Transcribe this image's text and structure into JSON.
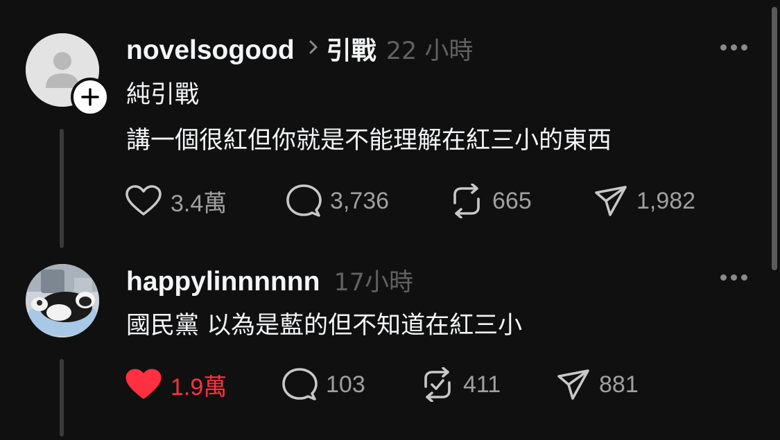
{
  "posts": [
    {
      "username": "novelsogood",
      "quoted": "引戰",
      "time": "22 小時",
      "lines": [
        "純引戰",
        "講一個很紅但你就是不能理解在紅三小的東西"
      ],
      "likes": "3.4萬",
      "liked": false,
      "comments": "3,736",
      "reposts": "665",
      "shares": "1,982"
    },
    {
      "username": "happylinnnnnn",
      "time": "17小時",
      "lines": [
        "國民黨 以為是藍的但不知道在紅三小"
      ],
      "likes": "1.9萬",
      "liked": true,
      "comments": "103",
      "reposts": "411",
      "shares": "881"
    }
  ],
  "colors": {
    "background": "#101010",
    "text": "#f3f5f7",
    "muted": "#a0a0a0",
    "time": "#616161",
    "like_active": "#ff3040"
  },
  "icons": [
    "person-placeholder-icon",
    "plus-icon",
    "chevron-right-icon",
    "more-icon",
    "heart-icon",
    "comment-icon",
    "repost-icon",
    "share-icon"
  ]
}
